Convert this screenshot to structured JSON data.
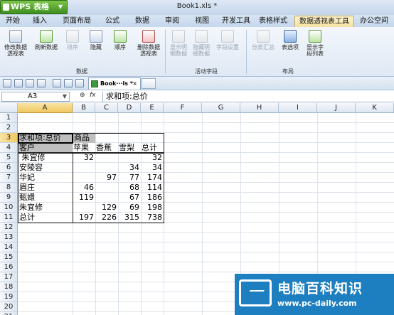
{
  "app": {
    "name": "WPS 表格",
    "doc_title": "Book1.xls *"
  },
  "tabs": [
    {
      "label": "开始"
    },
    {
      "label": "插入"
    },
    {
      "label": "页面布局"
    },
    {
      "label": "公式"
    },
    {
      "label": "数据"
    },
    {
      "label": "审阅"
    },
    {
      "label": "视图"
    },
    {
      "label": "开发工具"
    },
    {
      "label": "表格样式"
    },
    {
      "label": "数据透视表工具"
    },
    {
      "label": "办公空间"
    }
  ],
  "ribbon": {
    "buttons": [
      {
        "label": "修改数据\n透视表",
        "enabled": true,
        "icon": "table-edit-icon"
      },
      {
        "label": "刷新数据",
        "enabled": true,
        "icon": "refresh-icon"
      },
      {
        "label": "排序",
        "enabled": false,
        "icon": "sort-icon"
      },
      {
        "label": "隐藏",
        "enabled": true,
        "icon": "hide-icon"
      },
      {
        "label": "顺序",
        "enabled": true,
        "icon": "order-icon"
      },
      {
        "label": "删除数据\n透视表",
        "enabled": true,
        "icon": "delete-pivot-icon"
      },
      {
        "label": "显示明\n细数据",
        "enabled": false,
        "icon": "show-detail-icon"
      },
      {
        "label": "隐藏明\n细数据",
        "enabled": false,
        "icon": "hide-detail-icon"
      },
      {
        "label": "字段设置",
        "enabled": false,
        "icon": "field-settings-icon"
      },
      {
        "label": "分类汇总",
        "enabled": false,
        "icon": "subtotal-icon"
      },
      {
        "label": "表选项",
        "enabled": true,
        "icon": "table-options-icon"
      },
      {
        "label": "显示字\n段列表",
        "enabled": true,
        "icon": "field-list-icon"
      }
    ],
    "groups": [
      "数据",
      "活动字段",
      "布局"
    ]
  },
  "doc_tab": {
    "label": "Book···ls",
    "modified": "*",
    "close": "×"
  },
  "formula_bar": {
    "name_box": "A3",
    "fx_symbol": "fx",
    "formula": "求和项:总价"
  },
  "columns": [
    "A",
    "B",
    "C",
    "D",
    "E",
    "F",
    "G",
    "H",
    "I",
    "J",
    "K"
  ],
  "rows": [
    "1",
    "2",
    "3",
    "4",
    "5",
    "6",
    "7",
    "8",
    "9",
    "10",
    "11",
    "12",
    "13",
    "14",
    "15",
    "16",
    "17",
    "18",
    "19",
    "20",
    "21"
  ],
  "selected_cell": {
    "col": "A",
    "row": "3"
  },
  "pivot": {
    "corner_label": "求和项:总价",
    "column_field": "商品",
    "row_field": "客户",
    "columns": [
      "苹果",
      "香蕉",
      "雪梨",
      "总计"
    ],
    "rows": [
      {
        "label": " 朱宜修",
        "values": [
          "32",
          "",
          "",
          "32"
        ]
      },
      {
        "label": "安陵容",
        "values": [
          "",
          "",
          "34",
          "34"
        ]
      },
      {
        "label": "华妃",
        "values": [
          "",
          "97",
          "77",
          "174"
        ]
      },
      {
        "label": "眉庄",
        "values": [
          "46",
          "",
          "68",
          "114"
        ]
      },
      {
        "label": "甄嬛",
        "values": [
          "119",
          "",
          "67",
          "186"
        ]
      },
      {
        "label": "朱宜修",
        "values": [
          "",
          "129",
          "69",
          "198"
        ]
      },
      {
        "label": "总计",
        "values": [
          "197",
          "226",
          "315",
          "738"
        ]
      }
    ]
  },
  "watermark": {
    "title": "电脑百科知识",
    "url": "www.pc-daily.com"
  }
}
